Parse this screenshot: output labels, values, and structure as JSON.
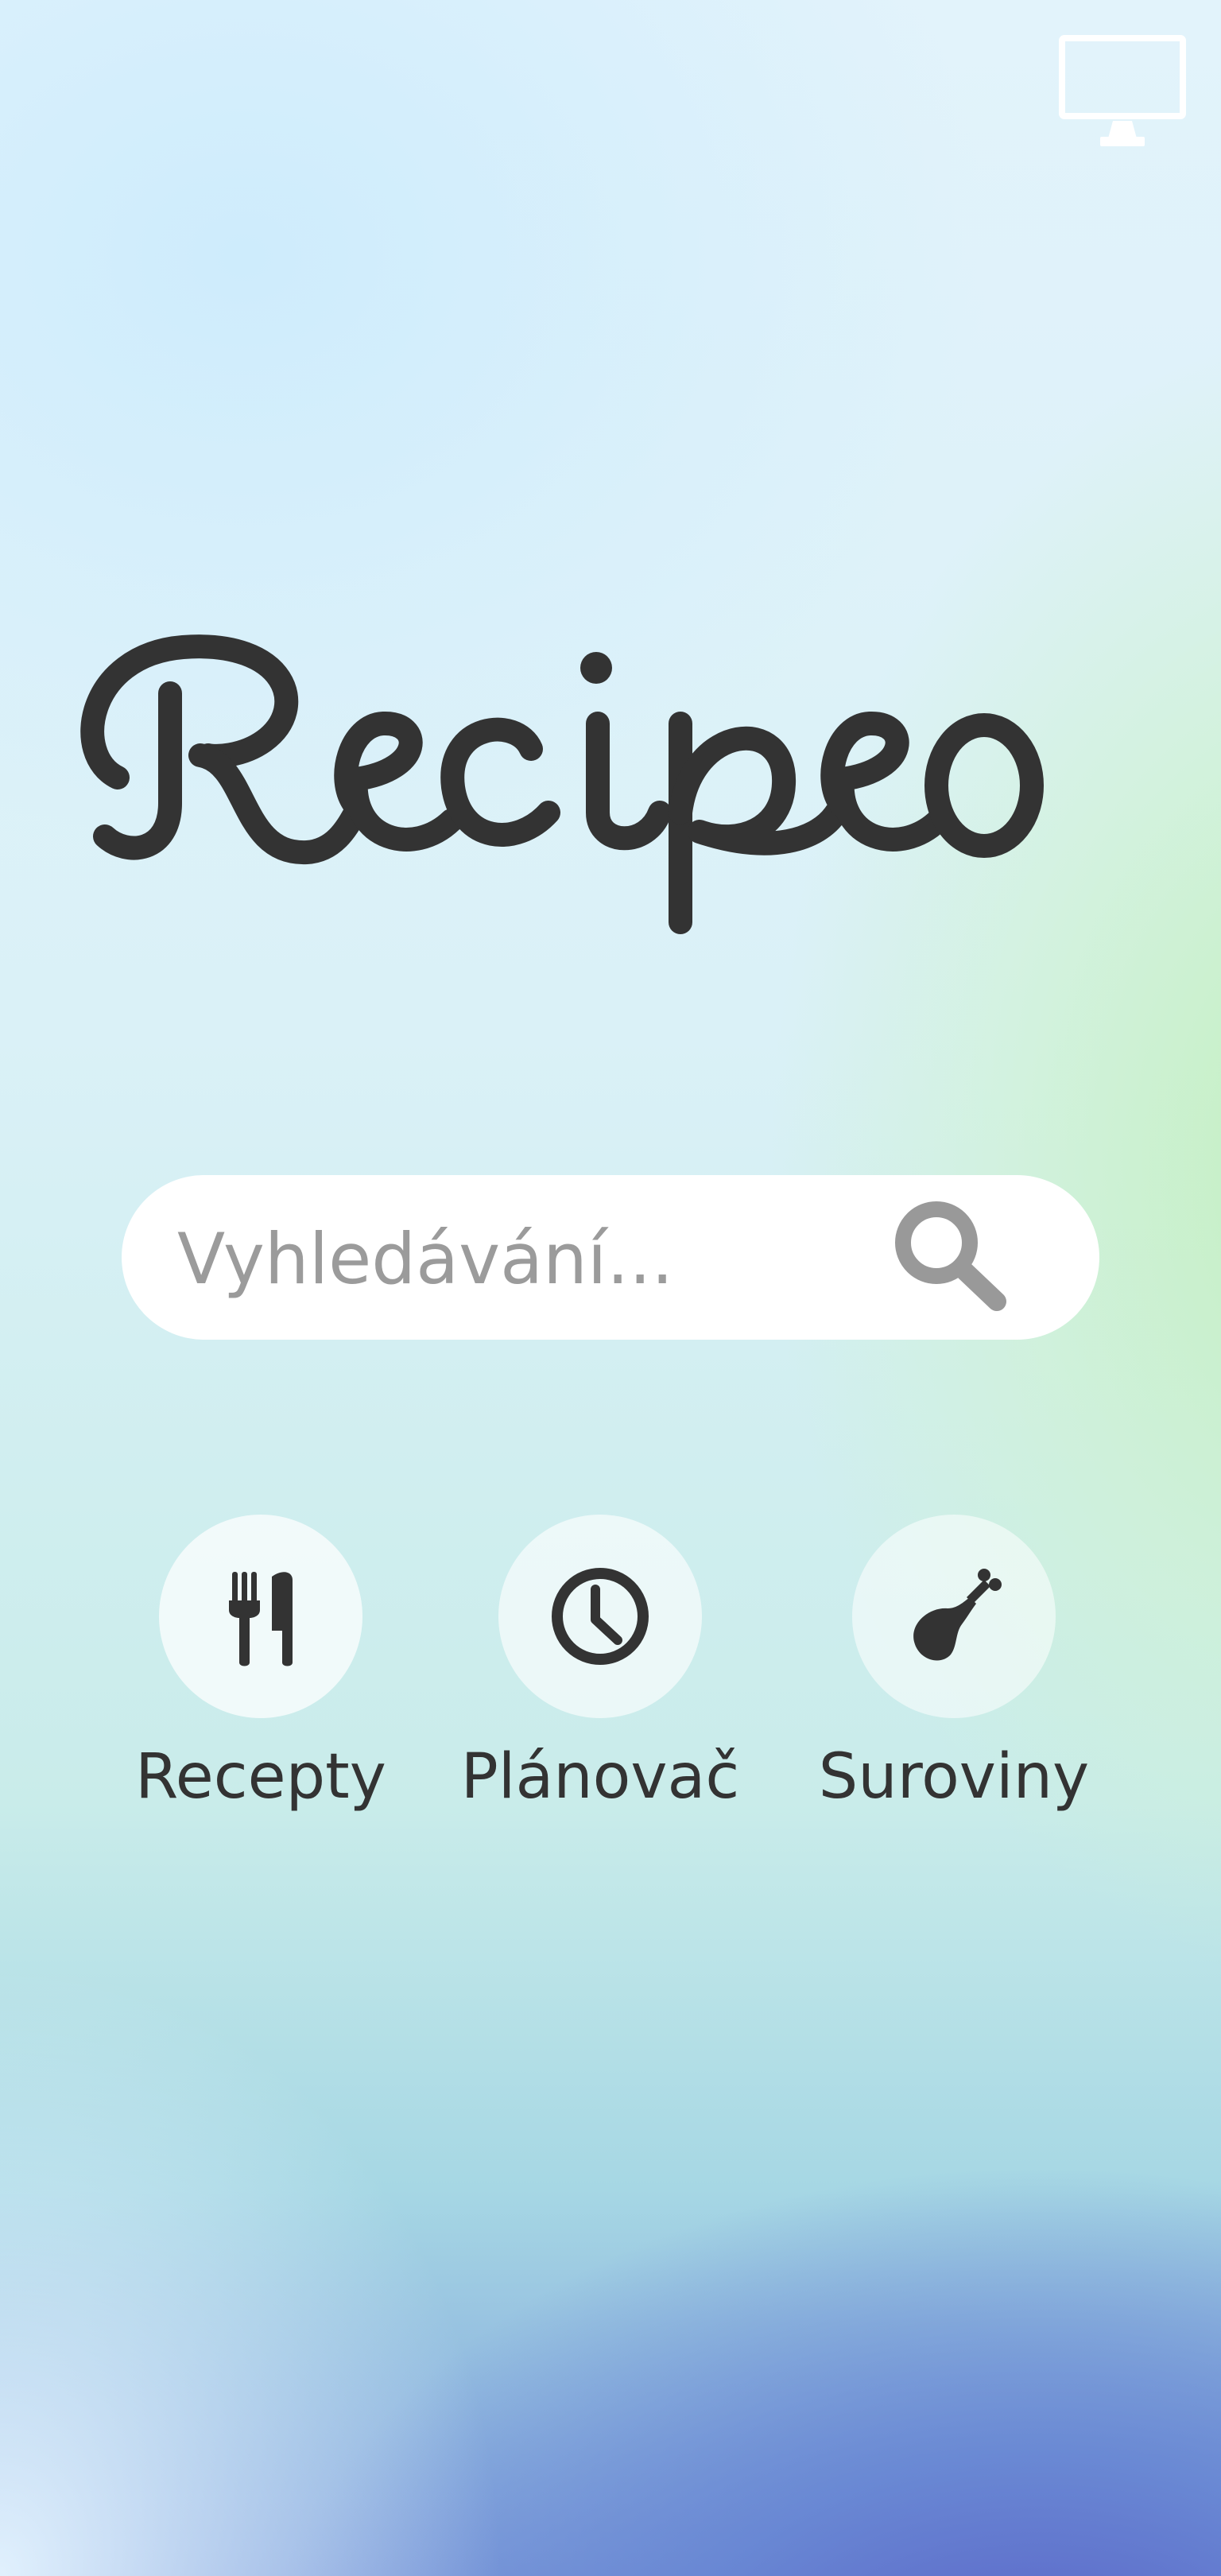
{
  "app": {
    "logo_text": "Recipeo"
  },
  "top_bar": {
    "icon": "monitor-icon"
  },
  "search": {
    "placeholder": "Vyhledávání...",
    "value": "",
    "icon": "magnifier-icon"
  },
  "shortcuts": [
    {
      "label": "Recepty",
      "icon": "fork-knife-icon"
    },
    {
      "label": "Plánovač",
      "icon": "clock-icon"
    },
    {
      "label": "Suroviny",
      "icon": "drumstick-icon"
    }
  ],
  "colors": {
    "text_dark": "#333333",
    "placeholder": "#9b9b9b",
    "icon_gray": "#999999",
    "search_bg": "#ffffff"
  }
}
